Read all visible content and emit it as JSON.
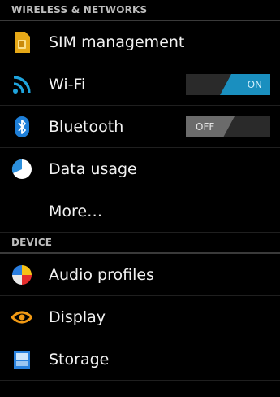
{
  "sections": {
    "wireless": {
      "title": "WIRELESS & NETWORKS"
    },
    "device": {
      "title": "DEVICE"
    }
  },
  "items": {
    "sim": {
      "label": "SIM management",
      "icon": "sim-card-icon"
    },
    "wifi": {
      "label": "Wi-Fi",
      "icon": "wifi-icon",
      "toggle": "ON",
      "toggle_state": "on"
    },
    "bluetooth": {
      "label": "Bluetooth",
      "icon": "bluetooth-icon",
      "toggle": "OFF",
      "toggle_state": "off"
    },
    "data_usage": {
      "label": "Data usage",
      "icon": "data-usage-icon"
    },
    "more": {
      "label": "More…"
    },
    "audio": {
      "label": "Audio profiles",
      "icon": "audio-profiles-icon"
    },
    "display": {
      "label": "Display",
      "icon": "display-icon"
    },
    "storage": {
      "label": "Storage",
      "icon": "storage-icon"
    }
  },
  "colors": {
    "background": "#000000",
    "toggle_on": "#1a8fbf",
    "toggle_off": "#6b6b6b",
    "header_text": "#bdbdbd"
  }
}
